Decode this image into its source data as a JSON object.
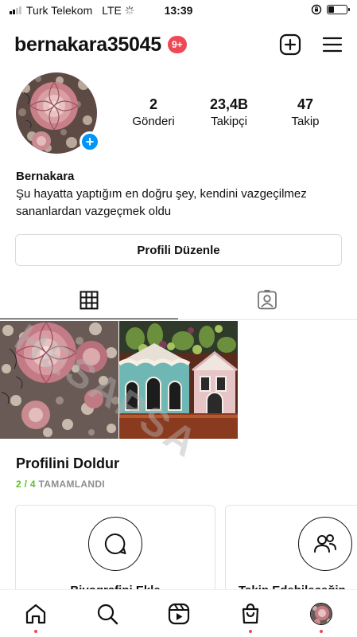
{
  "status_bar": {
    "carrier": "Turk Telekom",
    "network": "LTE",
    "time": "13:39"
  },
  "header": {
    "username": "bernakara35045",
    "notification_badge": "9+",
    "icons": [
      "new-post-icon",
      "menu-icon"
    ]
  },
  "profile": {
    "stats": [
      {
        "value": "2",
        "label": "Gönderi"
      },
      {
        "value": "23,4B",
        "label": "Takipçi"
      },
      {
        "value": "47",
        "label": "Takip"
      }
    ],
    "name": "Bernakara",
    "bio": "Şu hayatta yaptığım en doğru şey, kendini vazgeçilmez sananlardan vazgeçmek oldu",
    "edit_button": "Profili Düzenle"
  },
  "tabs": [
    {
      "icon": "grid-icon",
      "selected": true
    },
    {
      "icon": "tagged-icon",
      "selected": false
    }
  ],
  "posts": [
    {
      "subject": "pink succulent rosettes among pebbles"
    },
    {
      "subject": "decorative mini house planters with succulents"
    }
  ],
  "profile_completion": {
    "title": "Profilini Doldur",
    "progress_count": "2 / 4",
    "progress_label": "TAMAMLANDI",
    "cards": [
      {
        "title": "Biyografini Ekle",
        "icon": "speech-bubble-icon"
      },
      {
        "title": "Takip Edebileceğin",
        "icon": "people-icon"
      }
    ]
  },
  "watermark": "HESAPSA",
  "bottom_nav": [
    "home-icon",
    "search-icon",
    "reels-icon",
    "shop-icon",
    "profile-avatar"
  ],
  "colors": {
    "badge": "#ed4956",
    "accent_blue": "#0095f6",
    "progress_green": "#58c322"
  }
}
